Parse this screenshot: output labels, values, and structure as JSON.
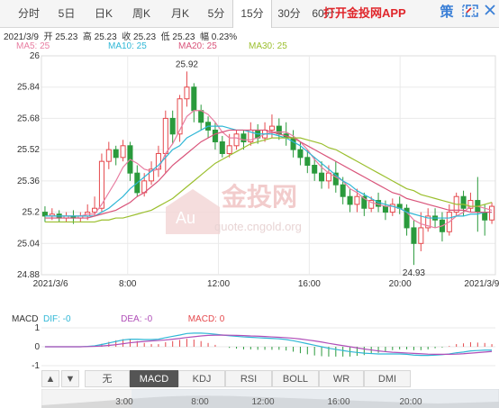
{
  "tabs": [
    {
      "label": "分时",
      "active": false
    },
    {
      "label": "5日",
      "active": false
    },
    {
      "label": "日K",
      "active": false
    },
    {
      "label": "周K",
      "active": false
    },
    {
      "label": "月K",
      "active": false
    },
    {
      "label": "5分",
      "active": false
    },
    {
      "label": "15分",
      "active": true
    },
    {
      "label": "30分",
      "active": false
    },
    {
      "label": "60分",
      "active": false
    }
  ],
  "app_link": "打开金投网APP",
  "tools": {
    "strategy_icon": "策",
    "edit_icon": "edit-icon",
    "fullscreen_icon": "fullscreen-icon",
    "close_icon": "close-icon"
  },
  "info": {
    "date": "2021/3/9",
    "open_label": "开",
    "open": "25.23",
    "high_label": "高",
    "high": "25.23",
    "close_label": "收",
    "close": "25.23",
    "low_label": "低",
    "low": "25.23",
    "change_label": "幅",
    "change": "0.23%"
  },
  "ma": [
    {
      "label": "MA5: 25",
      "color": "#e87da1"
    },
    {
      "label": "MA10: 25",
      "color": "#2fb7d6"
    },
    {
      "label": "MA20: 25",
      "color": "#d9547a"
    },
    {
      "label": "MA30: 25",
      "color": "#9bbf2e"
    }
  ],
  "watermark": {
    "brand": "金投网",
    "url": "quote.cngold.org"
  },
  "colors": {
    "up": "#e5494d",
    "down": "#2a9a3c",
    "grid": "#eaeaea",
    "axis": "#999"
  },
  "chart_data": {
    "type": "candlestick",
    "ylim": [
      24.88,
      26.0
    ],
    "yticks": [
      "26",
      "25.84",
      "25.68",
      "25.52",
      "25.36",
      "25.2",
      "25.04",
      "24.88"
    ],
    "xticks": [
      "2021/3/6",
      "8:00",
      "12:00",
      "16:00",
      "20:00",
      "2021/3/9"
    ],
    "annotations": [
      {
        "label": "25.92",
        "value": 25.92
      },
      {
        "label": "24.93",
        "value": 24.93
      }
    ],
    "candles": [
      [
        25.2,
        25.18,
        25.23,
        25.15
      ],
      [
        25.18,
        25.19,
        25.22,
        25.16
      ],
      [
        25.19,
        25.17,
        25.21,
        25.15
      ],
      [
        25.17,
        25.18,
        25.2,
        25.15
      ],
      [
        25.18,
        25.17,
        25.21,
        25.14
      ],
      [
        25.17,
        25.18,
        25.2,
        25.15
      ],
      [
        25.18,
        25.2,
        25.24,
        25.16
      ],
      [
        25.2,
        25.22,
        25.28,
        25.18
      ],
      [
        25.22,
        25.46,
        25.5,
        25.2
      ],
      [
        25.46,
        25.52,
        25.56,
        25.42
      ],
      [
        25.52,
        25.48,
        25.54,
        25.44
      ],
      [
        25.48,
        25.54,
        25.57,
        25.46
      ],
      [
        25.54,
        25.4,
        25.56,
        25.36
      ],
      [
        25.4,
        25.3,
        25.44,
        25.28
      ],
      [
        25.3,
        25.36,
        25.4,
        25.28
      ],
      [
        25.36,
        25.42,
        25.46,
        25.34
      ],
      [
        25.42,
        25.5,
        25.54,
        25.38
      ],
      [
        25.5,
        25.68,
        25.72,
        25.4
      ],
      [
        25.68,
        25.6,
        25.72,
        25.55
      ],
      [
        25.6,
        25.78,
        25.8,
        25.56
      ],
      [
        25.78,
        25.84,
        25.92,
        25.74
      ],
      [
        25.84,
        25.72,
        25.86,
        25.66
      ],
      [
        25.72,
        25.66,
        25.75,
        25.62
      ],
      [
        25.66,
        25.62,
        25.69,
        25.58
      ],
      [
        25.62,
        25.56,
        25.66,
        25.52
      ],
      [
        25.56,
        25.5,
        25.59,
        25.48
      ],
      [
        25.5,
        25.54,
        25.6,
        25.48
      ],
      [
        25.54,
        25.6,
        25.62,
        25.52
      ],
      [
        25.6,
        25.56,
        25.62,
        25.52
      ],
      [
        25.56,
        25.62,
        25.66,
        25.54
      ],
      [
        25.62,
        25.58,
        25.65,
        25.55
      ],
      [
        25.58,
        25.62,
        25.66,
        25.56
      ],
      [
        25.62,
        25.64,
        25.7,
        25.58
      ],
      [
        25.64,
        25.6,
        25.68,
        25.57
      ],
      [
        25.6,
        25.58,
        25.66,
        25.54
      ],
      [
        25.58,
        25.52,
        25.62,
        25.48
      ],
      [
        25.52,
        25.48,
        25.56,
        25.44
      ],
      [
        25.48,
        25.44,
        25.52,
        25.4
      ],
      [
        25.44,
        25.4,
        25.48,
        25.36
      ],
      [
        25.4,
        25.36,
        25.46,
        25.32
      ],
      [
        25.36,
        25.4,
        25.44,
        25.32
      ],
      [
        25.4,
        25.34,
        25.46,
        25.3
      ],
      [
        25.34,
        25.28,
        25.38,
        25.24
      ],
      [
        25.28,
        25.24,
        25.32,
        25.2
      ],
      [
        25.24,
        25.28,
        25.32,
        25.2
      ],
      [
        25.28,
        25.22,
        25.3,
        25.18
      ],
      [
        25.22,
        25.26,
        25.28,
        25.2
      ],
      [
        25.26,
        25.23,
        25.3,
        25.2
      ],
      [
        25.23,
        25.2,
        25.26,
        25.16
      ],
      [
        25.2,
        25.24,
        25.27,
        25.18
      ],
      [
        25.24,
        25.22,
        25.28,
        25.19
      ],
      [
        25.22,
        25.12,
        25.24,
        25.08
      ],
      [
        25.12,
        25.04,
        25.16,
        24.93
      ],
      [
        25.04,
        25.12,
        25.2,
        25.0
      ],
      [
        25.12,
        25.18,
        25.22,
        25.1
      ],
      [
        25.18,
        25.16,
        25.22,
        25.12
      ],
      [
        25.16,
        25.1,
        25.2,
        25.05
      ],
      [
        25.1,
        25.2,
        25.24,
        25.08
      ],
      [
        25.2,
        25.28,
        25.3,
        25.18
      ],
      [
        25.28,
        25.22,
        25.31,
        25.18
      ],
      [
        25.22,
        25.26,
        25.3,
        25.2
      ],
      [
        25.26,
        25.2,
        25.38,
        25.1
      ],
      [
        25.2,
        25.16,
        25.24,
        25.08
      ],
      [
        25.16,
        25.23,
        25.25,
        25.14
      ]
    ],
    "ma_series": [
      {
        "name": "MA5",
        "color": "#e87da1",
        "values": [
          25.18,
          25.18,
          25.18,
          25.18,
          25.18,
          25.18,
          25.19,
          25.19,
          25.24,
          25.3,
          25.36,
          25.43,
          25.47,
          25.45,
          25.42,
          25.41,
          25.42,
          25.5,
          25.55,
          25.62,
          25.69,
          25.72,
          25.72,
          25.7,
          25.66,
          25.61,
          25.58,
          25.58,
          25.57,
          25.57,
          25.58,
          25.6,
          25.61,
          25.61,
          25.61,
          25.59,
          25.56,
          25.52,
          25.47,
          25.43,
          25.4,
          25.38,
          25.36,
          25.32,
          25.3,
          25.27,
          25.25,
          25.24,
          25.23,
          25.23,
          25.22,
          25.2,
          25.16,
          25.14,
          25.13,
          25.12,
          25.13,
          25.15,
          25.18,
          25.2,
          25.23,
          25.23,
          25.22,
          25.21
        ]
      },
      {
        "name": "MA10",
        "color": "#2fb7d6",
        "values": [
          25.18,
          25.18,
          25.18,
          25.18,
          25.18,
          25.18,
          25.18,
          25.18,
          25.2,
          25.22,
          25.25,
          25.28,
          25.32,
          25.35,
          25.38,
          25.41,
          25.44,
          25.48,
          25.52,
          25.54,
          25.58,
          25.6,
          25.62,
          25.64,
          25.64,
          25.64,
          25.63,
          25.62,
          25.62,
          25.61,
          25.6,
          25.6,
          25.6,
          25.59,
          25.58,
          25.56,
          25.54,
          25.51,
          25.48,
          25.45,
          25.42,
          25.39,
          25.36,
          25.34,
          25.31,
          25.29,
          25.27,
          25.25,
          25.24,
          25.23,
          25.22,
          25.2,
          25.19,
          25.18,
          25.17,
          25.17,
          25.17,
          25.17,
          25.18,
          25.18,
          25.19,
          25.19,
          25.2,
          25.2
        ]
      },
      {
        "name": "MA20",
        "color": "#d9547a",
        "values": [
          25.17,
          25.17,
          25.17,
          25.17,
          25.17,
          25.17,
          25.17,
          25.18,
          25.19,
          25.2,
          25.21,
          25.23,
          25.25,
          25.28,
          25.3,
          25.33,
          25.36,
          25.4,
          25.44,
          25.47,
          25.5,
          25.53,
          25.56,
          25.58,
          25.6,
          25.61,
          25.62,
          25.62,
          25.62,
          25.62,
          25.62,
          25.62,
          25.61,
          25.6,
          25.59,
          25.58,
          25.56,
          25.54,
          25.52,
          25.5,
          25.48,
          25.46,
          25.44,
          25.42,
          25.4,
          25.38,
          25.36,
          25.34,
          25.32,
          25.3,
          25.29,
          25.27,
          25.26,
          25.25,
          25.24,
          25.23,
          25.22,
          25.21,
          25.21,
          25.21,
          25.2,
          25.2,
          25.2,
          25.2
        ]
      },
      {
        "name": "MA30",
        "color": "#9bbf2e",
        "values": [
          25.15,
          25.15,
          25.15,
          25.15,
          25.15,
          25.15,
          25.15,
          25.15,
          25.16,
          25.16,
          25.17,
          25.17,
          25.18,
          25.19,
          25.2,
          25.21,
          25.23,
          25.25,
          25.27,
          25.3,
          25.33,
          25.36,
          25.39,
          25.42,
          25.45,
          25.47,
          25.49,
          25.51,
          25.53,
          25.55,
          25.56,
          25.57,
          25.58,
          25.58,
          25.58,
          25.58,
          25.58,
          25.57,
          25.56,
          25.55,
          25.53,
          25.52,
          25.5,
          25.48,
          25.46,
          25.44,
          25.42,
          25.4,
          25.38,
          25.36,
          25.34,
          25.32,
          25.31,
          25.29,
          25.28,
          25.27,
          25.26,
          25.25,
          25.24,
          25.24,
          25.23,
          25.23,
          25.24,
          25.25
        ]
      }
    ]
  },
  "indicator": {
    "name": "MACD",
    "dif_label": "DIF: -0",
    "dea_label": "DEA: -0",
    "macd_label": "MACD: 0",
    "colors": {
      "dif": "#2fb7d6",
      "dea": "#b04fb8",
      "macd": "#e5494d"
    },
    "yticks": [
      "1",
      "0",
      "-1"
    ],
    "dif": [
      0,
      0,
      0,
      0,
      0,
      0,
      0.02,
      0.05,
      0.12,
      0.2,
      0.28,
      0.36,
      0.4,
      0.4,
      0.38,
      0.38,
      0.4,
      0.48,
      0.55,
      0.62,
      0.7,
      0.72,
      0.72,
      0.7,
      0.66,
      0.62,
      0.58,
      0.55,
      0.52,
      0.5,
      0.48,
      0.46,
      0.44,
      0.42,
      0.38,
      0.32,
      0.24,
      0.16,
      0.08,
      0,
      -0.08,
      -0.14,
      -0.2,
      -0.26,
      -0.3,
      -0.34,
      -0.36,
      -0.38,
      -0.38,
      -0.38,
      -0.38,
      -0.4,
      -0.44,
      -0.46,
      -0.46,
      -0.44,
      -0.42,
      -0.38,
      -0.32,
      -0.28,
      -0.22,
      -0.2,
      -0.18,
      -0.18
    ],
    "dea": [
      0,
      0,
      0,
      0,
      0,
      0,
      0.01,
      0.02,
      0.04,
      0.07,
      0.11,
      0.16,
      0.21,
      0.25,
      0.28,
      0.31,
      0.33,
      0.36,
      0.4,
      0.44,
      0.49,
      0.53,
      0.57,
      0.6,
      0.61,
      0.62,
      0.61,
      0.6,
      0.59,
      0.57,
      0.56,
      0.54,
      0.52,
      0.5,
      0.48,
      0.45,
      0.41,
      0.36,
      0.31,
      0.25,
      0.18,
      0.12,
      0.06,
      0,
      -0.06,
      -0.12,
      -0.17,
      -0.22,
      -0.26,
      -0.29,
      -0.31,
      -0.33,
      -0.35,
      -0.37,
      -0.39,
      -0.4,
      -0.4,
      -0.4,
      -0.39,
      -0.37,
      -0.34,
      -0.31,
      -0.28,
      -0.25
    ],
    "buttons": [
      {
        "label": "无",
        "active": false
      },
      {
        "label": "MACD",
        "active": true
      },
      {
        "label": "KDJ",
        "active": false
      },
      {
        "label": "RSI",
        "active": false
      },
      {
        "label": "BOLL",
        "active": false
      },
      {
        "label": "WR",
        "active": false
      },
      {
        "label": "DMI",
        "active": false
      }
    ],
    "nav_labels": [
      "3:00",
      "8:00",
      "12:00",
      "16:00",
      "20:00"
    ]
  }
}
